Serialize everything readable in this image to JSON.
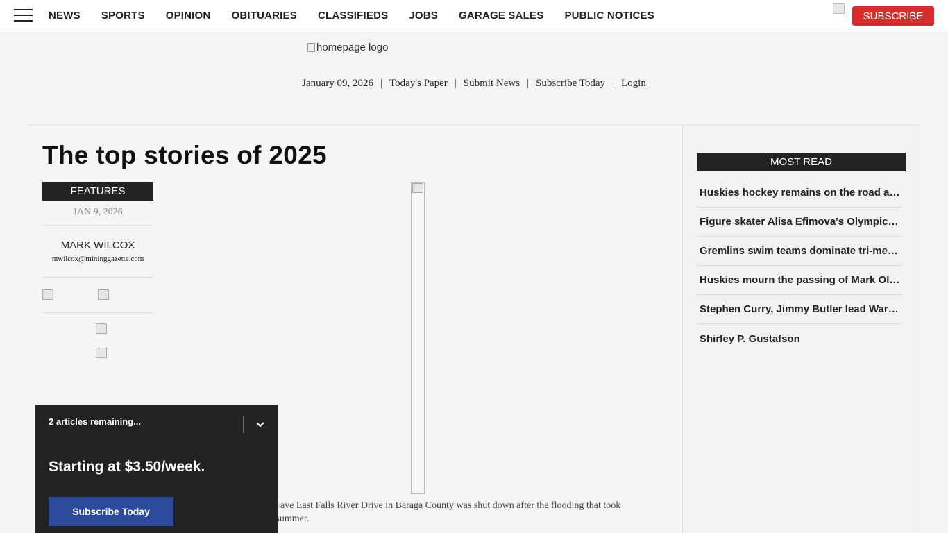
{
  "nav": {
    "items": [
      "NEWS",
      "SPORTS",
      "OPINION",
      "OBITUARIES",
      "CLASSIFIEDS",
      "JOBS",
      "GARAGE SALES",
      "PUBLIC NOTICES"
    ],
    "subscribe_label": "SUBSCRIBE"
  },
  "masthead": {
    "logo_alt": "homepage logo",
    "date": "January 09, 2026",
    "links": [
      "Today's Paper",
      "Submit News",
      "Subscribe Today",
      "Login"
    ],
    "separator": "|"
  },
  "article": {
    "headline": "The top stories of 2025",
    "section": "FEATURES",
    "date": "JAN 9, 2026",
    "author": "MARK WILCOX",
    "email": "mwilcox@mininggazette.com",
    "caption_line1": "aFave East Falls River Drive in Baraga County was shut down after the flooding that took",
    "caption_line2": "t summer."
  },
  "most_read": {
    "title": "MOST READ",
    "items": [
      "Huskies hockey remains on the road after...",
      "Figure skater Alisa Efimova's Olympic dream...",
      "Gremlins swim teams dominate tri-meet...",
      "Huskies mourn the passing of Mark Olson...",
      "Stephen Curry, Jimmy Butler lead Warriors...",
      "Shirley P. Gustafson"
    ]
  },
  "paywall": {
    "remaining": "2 articles remaining...",
    "price": "Starting at $3.50/week.",
    "button": "Subscribe Today"
  },
  "colors": {
    "subscribe_red": "#d32f2f",
    "dark": "#222222",
    "paywall_button": "#2b4a9c"
  }
}
